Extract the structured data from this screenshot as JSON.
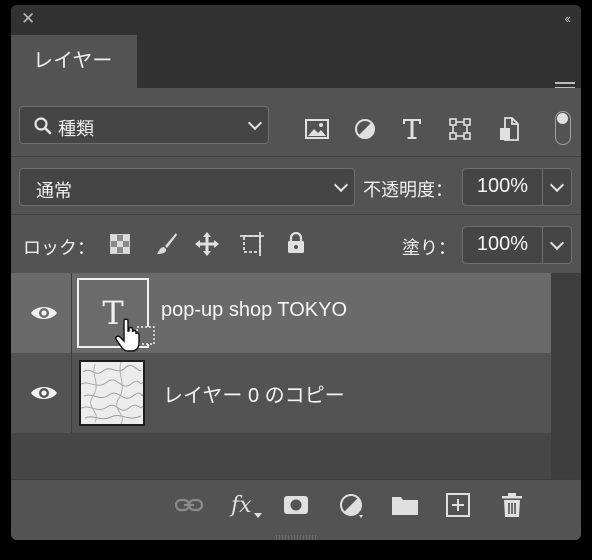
{
  "panel": {
    "tab_title": "レイヤー",
    "close_icon": "close-icon",
    "collapse_icon": "double-chevron-icon",
    "menu_icon": "panel-menu-icon"
  },
  "filter": {
    "kind_label": "種類",
    "icons": [
      "image-filter-icon",
      "adjustment-filter-icon",
      "type-filter-icon",
      "shape-filter-icon",
      "smart-object-filter-icon"
    ]
  },
  "blend": {
    "mode": "通常",
    "opacity_label": "不透明度：",
    "opacity_value": "100%"
  },
  "lock": {
    "label": "ロック：",
    "fill_label": "塗り：",
    "fill_value": "100%",
    "icons": [
      "lock-transparent-pixels-icon",
      "lock-image-pixels-icon",
      "lock-position-icon",
      "artboard-lock-icon",
      "lock-all-icon"
    ]
  },
  "layers": [
    {
      "name": "pop-up shop TOKYO",
      "type": "text",
      "thumb_glyph": "T",
      "selected": true
    },
    {
      "name": "レイヤー 0 のコピー",
      "type": "raster",
      "selected": false
    }
  ],
  "bottom": {
    "icons": [
      "link-layers-icon",
      "fx-icon",
      "add-mask-icon",
      "new-adjustment-icon",
      "new-group-icon",
      "new-layer-icon",
      "trash-icon"
    ],
    "fx_label": "fx"
  },
  "colors": {
    "panel_bg": "#535353",
    "selected_layer": "#6a6a6a",
    "dark_bg": "#323232"
  }
}
